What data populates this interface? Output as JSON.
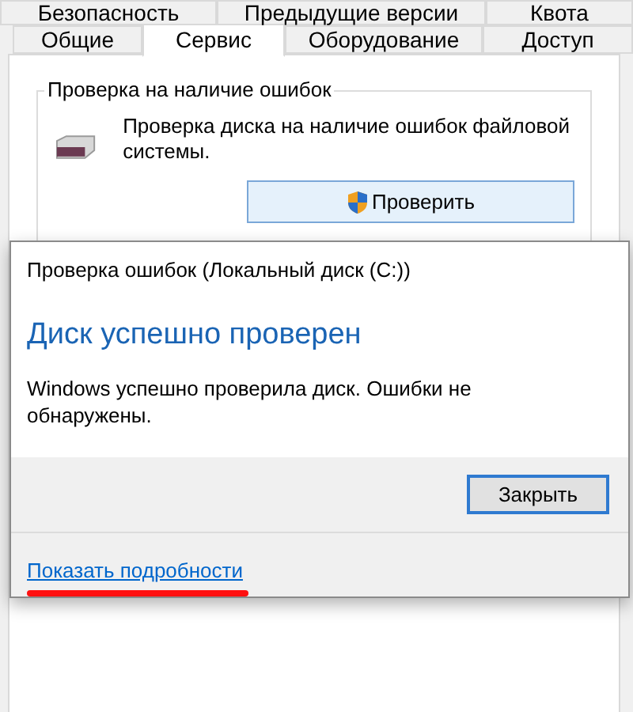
{
  "tabs_row_1": [
    {
      "label": "Безопасность",
      "selected": false
    },
    {
      "label": "Предыдущие версии",
      "selected": false
    },
    {
      "label": "Квота",
      "selected": false
    }
  ],
  "tabs_row_2": [
    {
      "label": "Общие",
      "selected": false
    },
    {
      "label": "Сервис",
      "selected": true
    },
    {
      "label": "Оборудование",
      "selected": false
    },
    {
      "label": "Доступ",
      "selected": false
    }
  ],
  "group": {
    "title": "Проверка на наличие ошибок",
    "description": "Проверка диска на наличие ошибок файловой системы.",
    "button": "Проверить"
  },
  "dialog": {
    "title": "Проверка ошибок (Локальный диск (C:))",
    "heading": "Диск успешно проверен",
    "message": "Windows успешно проверила диск. Ошибки не обнаружены.",
    "close_button": "Закрыть",
    "details_link": "Показать подробности",
    "details_link_highlighted": true
  }
}
